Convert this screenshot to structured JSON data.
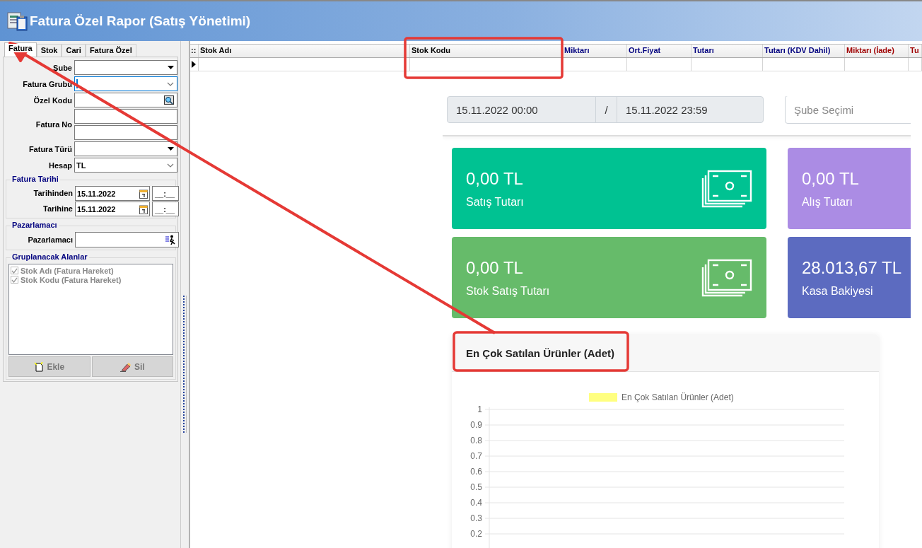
{
  "window": {
    "title": "Fatura Özel Rapor (Satış Yönetimi)"
  },
  "filter_panel": {
    "tabs": [
      {
        "label": "Fatura",
        "selected": true
      },
      {
        "label": "Stok",
        "selected": false
      },
      {
        "label": "Cari",
        "selected": false
      },
      {
        "label": "Fatura Özel",
        "selected": false
      }
    ],
    "fields": [
      {
        "kind": "dropdown",
        "label": "Şube",
        "focused": false
      },
      {
        "kind": "combo",
        "label": "Fatura Grubu",
        "focused": true
      },
      {
        "kind": "lookup",
        "label": "Özel Kodu",
        "focused": false
      },
      {
        "kind": "double_text",
        "label": "Fatura No",
        "focused": false
      },
      {
        "kind": "dropdown",
        "label": "Fatura Türü",
        "focused": false
      },
      {
        "kind": "combo",
        "label": "Hesap",
        "value": "TL",
        "focused": false
      }
    ],
    "date_group": {
      "title": "Fatura Tarihi",
      "rows": [
        {
          "label": "Tarihinden",
          "date": "15.11.2022",
          "time": "__:__"
        },
        {
          "label": "Tarihine",
          "date": "15.11.2022",
          "time": "__:__"
        }
      ]
    },
    "salesperson_group": {
      "title": "Pazarlamacı",
      "label": "Pazarlamacı"
    },
    "grouping_group": {
      "title": "Gruplanacak Alanlar",
      "items": [
        {
          "label": "Stok Adı  (Fatura Hareket)",
          "checked": true,
          "disabled": true
        },
        {
          "label": "Stok Kodu  (Fatura Hareket)",
          "checked": true,
          "disabled": true
        }
      ],
      "buttons": [
        {
          "kind": "add",
          "label": "Ekle",
          "disabled": true
        },
        {
          "kind": "delete",
          "label": "Sil",
          "disabled": true
        }
      ]
    }
  },
  "grid": {
    "corner": "::",
    "columns": [
      {
        "label": "Stok Adı",
        "color": "#000000"
      },
      {
        "label": "Stok Kodu",
        "color": "#000000"
      },
      {
        "label": "Miktarı",
        "color": "#00007f"
      },
      {
        "label": "Ort.Fiyat",
        "color": "#00007f"
      },
      {
        "label": "Tutarı",
        "color": "#00007f"
      },
      {
        "label": "Tutarı (KDV Dahil)",
        "color": "#00007f"
      },
      {
        "label": "Miktarı (İade)",
        "color": "#9f0000"
      },
      {
        "label": "Tu",
        "color": "#9f0000"
      }
    ],
    "rows": [
      {
        "current": true
      }
    ]
  },
  "dashboard": {
    "date_range": {
      "start": "15.11.2022 00:00",
      "separator": "/",
      "end": "15.11.2022 23:59"
    },
    "branch_select": {
      "placeholder": "Şube Seçimi"
    },
    "cards": [
      {
        "value": "0,00 TL",
        "label": "Satış Tutarı",
        "color": "#00c292"
      },
      {
        "value": "0,00 TL",
        "label": "Alış Tutarı",
        "color": "#ab8ce4"
      },
      {
        "value": "0,00 TL",
        "label": "Stok Satış Tutarı",
        "color": "#66bb6a"
      },
      {
        "value": "28.013,67 TL",
        "label": "Kasa Bakiyesi",
        "color": "#5c6bc0"
      }
    ],
    "chart_panel": {
      "title": "En Çok Satılan Ürünler (Adet)",
      "chart_data": {
        "type": "bar",
        "series": [
          {
            "name": "En Çok Satılan Ürünler (Adet)",
            "color": "#ffff80"
          }
        ],
        "ylim": [
          0,
          1
        ],
        "grid": true,
        "yticks": [
          0.2,
          0.3,
          0.4,
          0.5,
          0.6,
          0.7,
          0.8,
          0.9,
          1
        ]
      }
    }
  }
}
